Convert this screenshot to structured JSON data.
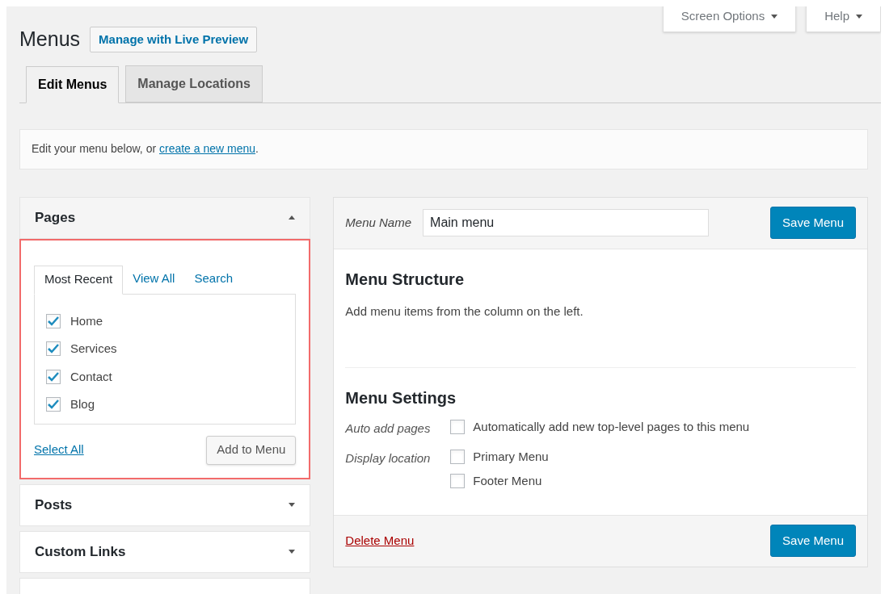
{
  "top_buttons": [
    {
      "label": "Screen Options"
    },
    {
      "label": "Help"
    }
  ],
  "title": "Menus",
  "title_action": "Manage with Live Preview",
  "tabs": [
    {
      "label": "Edit Menus",
      "selected": true
    },
    {
      "label": "Manage Locations",
      "selected": false
    }
  ],
  "notice": {
    "text": "Edit your menu below, or ",
    "link": "create a new menu",
    "after": "."
  },
  "sidebar": {
    "sections": [
      {
        "title": "Pages",
        "expanded": true,
        "highlighted": true,
        "tabs": [
          {
            "label": "Most Recent",
            "selected": true
          },
          {
            "label": "View All",
            "selected": false
          },
          {
            "label": "Search",
            "selected": false
          }
        ],
        "items": [
          {
            "label": "Home",
            "checked": true
          },
          {
            "label": "Services",
            "checked": true
          },
          {
            "label": "Contact",
            "checked": true
          },
          {
            "label": "Blog",
            "checked": true
          }
        ],
        "select_all": "Select All",
        "add_button": "Add to Menu"
      },
      {
        "title": "Posts",
        "expanded": false
      },
      {
        "title": "Custom Links",
        "expanded": false
      }
    ]
  },
  "editor": {
    "menu_name_label": "Menu Name",
    "menu_name": "Main menu",
    "save": "Save Menu",
    "structure_title": "Menu Structure",
    "structure_hint": "Add menu items from the column on the left.",
    "settings_title": "Menu Settings",
    "settings": [
      {
        "label": "Auto add pages",
        "options": [
          {
            "label": "Automatically add new top-level pages to this menu",
            "checked": false
          }
        ]
      },
      {
        "label": "Display location",
        "options": [
          {
            "label": "Primary Menu",
            "checked": false
          },
          {
            "label": "Footer Menu",
            "checked": false
          }
        ]
      }
    ],
    "delete": "Delete Menu",
    "save_bottom": "Save Menu"
  }
}
